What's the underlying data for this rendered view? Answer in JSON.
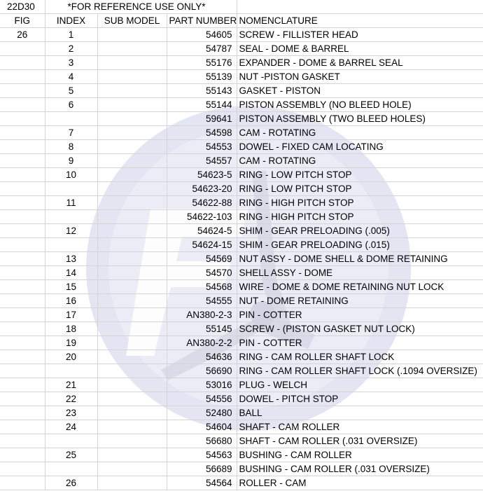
{
  "header": {
    "code": "22D30",
    "note": "*FOR REFERENCE USE ONLY*"
  },
  "columns": {
    "fig": "FIG",
    "index": "INDEX",
    "sub_model": "SUB MODEL",
    "part_number": "PART NUMBER",
    "nomenclature": "NOMENCLATURE"
  },
  "rows": [
    {
      "fig": "26",
      "index": "1",
      "sub": "",
      "part": "54605",
      "nom": "SCREW - FILLISTER HEAD"
    },
    {
      "fig": "",
      "index": "2",
      "sub": "",
      "part": "54787",
      "nom": "SEAL - DOME & BARREL"
    },
    {
      "fig": "",
      "index": "3",
      "sub": "",
      "part": "55176",
      "nom": "EXPANDER - DOME & BARREL SEAL"
    },
    {
      "fig": "",
      "index": "4",
      "sub": "",
      "part": "55139",
      "nom": "NUT -PISTON GASKET"
    },
    {
      "fig": "",
      "index": "5",
      "sub": "",
      "part": "55143",
      "nom": "GASKET - PISTON"
    },
    {
      "fig": "",
      "index": "6",
      "sub": "",
      "part": "55144",
      "nom": "PISTON ASSEMBLY (NO BLEED HOLE)"
    },
    {
      "fig": "",
      "index": "",
      "sub": "",
      "part": "59641",
      "nom": "PISTON ASSEMBLY (TWO BLEED HOLES)"
    },
    {
      "fig": "",
      "index": "7",
      "sub": "",
      "part": "54598",
      "nom": "CAM - ROTATING"
    },
    {
      "fig": "",
      "index": "8",
      "sub": "",
      "part": "54553",
      "nom": "DOWEL - FIXED CAM LOCATING"
    },
    {
      "fig": "",
      "index": "9",
      "sub": "",
      "part": "54557",
      "nom": "CAM - ROTATING"
    },
    {
      "fig": "",
      "index": "10",
      "sub": "",
      "part": "54623-5",
      "nom": "RING - LOW PITCH STOP"
    },
    {
      "fig": "",
      "index": "",
      "sub": "",
      "part": "54623-20",
      "nom": "RING - LOW PITCH STOP"
    },
    {
      "fig": "",
      "index": "11",
      "sub": "",
      "part": "54622-88",
      "nom": "RING - HIGH PITCH STOP"
    },
    {
      "fig": "",
      "index": "",
      "sub": "",
      "part": "54622-103",
      "nom": "RING - HIGH PITCH STOP"
    },
    {
      "fig": "",
      "index": "12",
      "sub": "",
      "part": "54624-5",
      "nom": "SHIM - GEAR PRELOADING (.005)"
    },
    {
      "fig": "",
      "index": "",
      "sub": "",
      "part": "54624-15",
      "nom": "SHIM - GEAR PRELOADING (.015)"
    },
    {
      "fig": "",
      "index": "13",
      "sub": "",
      "part": "54569",
      "nom": "NUT ASSY - DOME SHELL & DOME RETAINING"
    },
    {
      "fig": "",
      "index": "14",
      "sub": "",
      "part": "54570",
      "nom": "SHELL ASSY - DOME"
    },
    {
      "fig": "",
      "index": "15",
      "sub": "",
      "part": "54568",
      "nom": "WIRE - DOME & DOME RETAINING NUT LOCK"
    },
    {
      "fig": "",
      "index": "16",
      "sub": "",
      "part": "54555",
      "nom": "NUT - DOME RETAINING"
    },
    {
      "fig": "",
      "index": "17",
      "sub": "",
      "part": "AN380-2-3",
      "nom": "PIN - COTTER"
    },
    {
      "fig": "",
      "index": "18",
      "sub": "",
      "part": "55145",
      "nom": "SCREW - (PISTON GASKET NUT LOCK)"
    },
    {
      "fig": "",
      "index": "19",
      "sub": "",
      "part": "AN380-2-2",
      "nom": "PIN - COTTER"
    },
    {
      "fig": "",
      "index": "20",
      "sub": "",
      "part": "54636",
      "nom": "RING - CAM ROLLER SHAFT LOCK"
    },
    {
      "fig": "",
      "index": "",
      "sub": "",
      "part": "56690",
      "nom": "RING - CAM ROLLER SHAFT LOCK (.1094 OVERSIZE)"
    },
    {
      "fig": "",
      "index": "21",
      "sub": "",
      "part": "53016",
      "nom": "PLUG - WELCH"
    },
    {
      "fig": "",
      "index": "22",
      "sub": "",
      "part": "54556",
      "nom": "DOWEL - PITCH STOP"
    },
    {
      "fig": "",
      "index": "23",
      "sub": "",
      "part": "52480",
      "nom": "BALL"
    },
    {
      "fig": "",
      "index": "24",
      "sub": "",
      "part": "54604",
      "nom": "SHAFT - CAM ROLLER"
    },
    {
      "fig": "",
      "index": "",
      "sub": "",
      "part": "56680",
      "nom": "SHAFT - CAM ROLLER (.031 OVERSIZE)"
    },
    {
      "fig": "",
      "index": "25",
      "sub": "",
      "part": "54563",
      "nom": "BUSHING - CAM ROLLER"
    },
    {
      "fig": "",
      "index": "",
      "sub": "",
      "part": "56689",
      "nom": "BUSHING - CAM ROLLER (.031 OVERSIZE)"
    },
    {
      "fig": "",
      "index": "26",
      "sub": "",
      "part": "54564",
      "nom": "ROLLER - CAM"
    }
  ],
  "watermark": {
    "icon": "propeller-logo-icon",
    "color": "#dfe1f0"
  }
}
